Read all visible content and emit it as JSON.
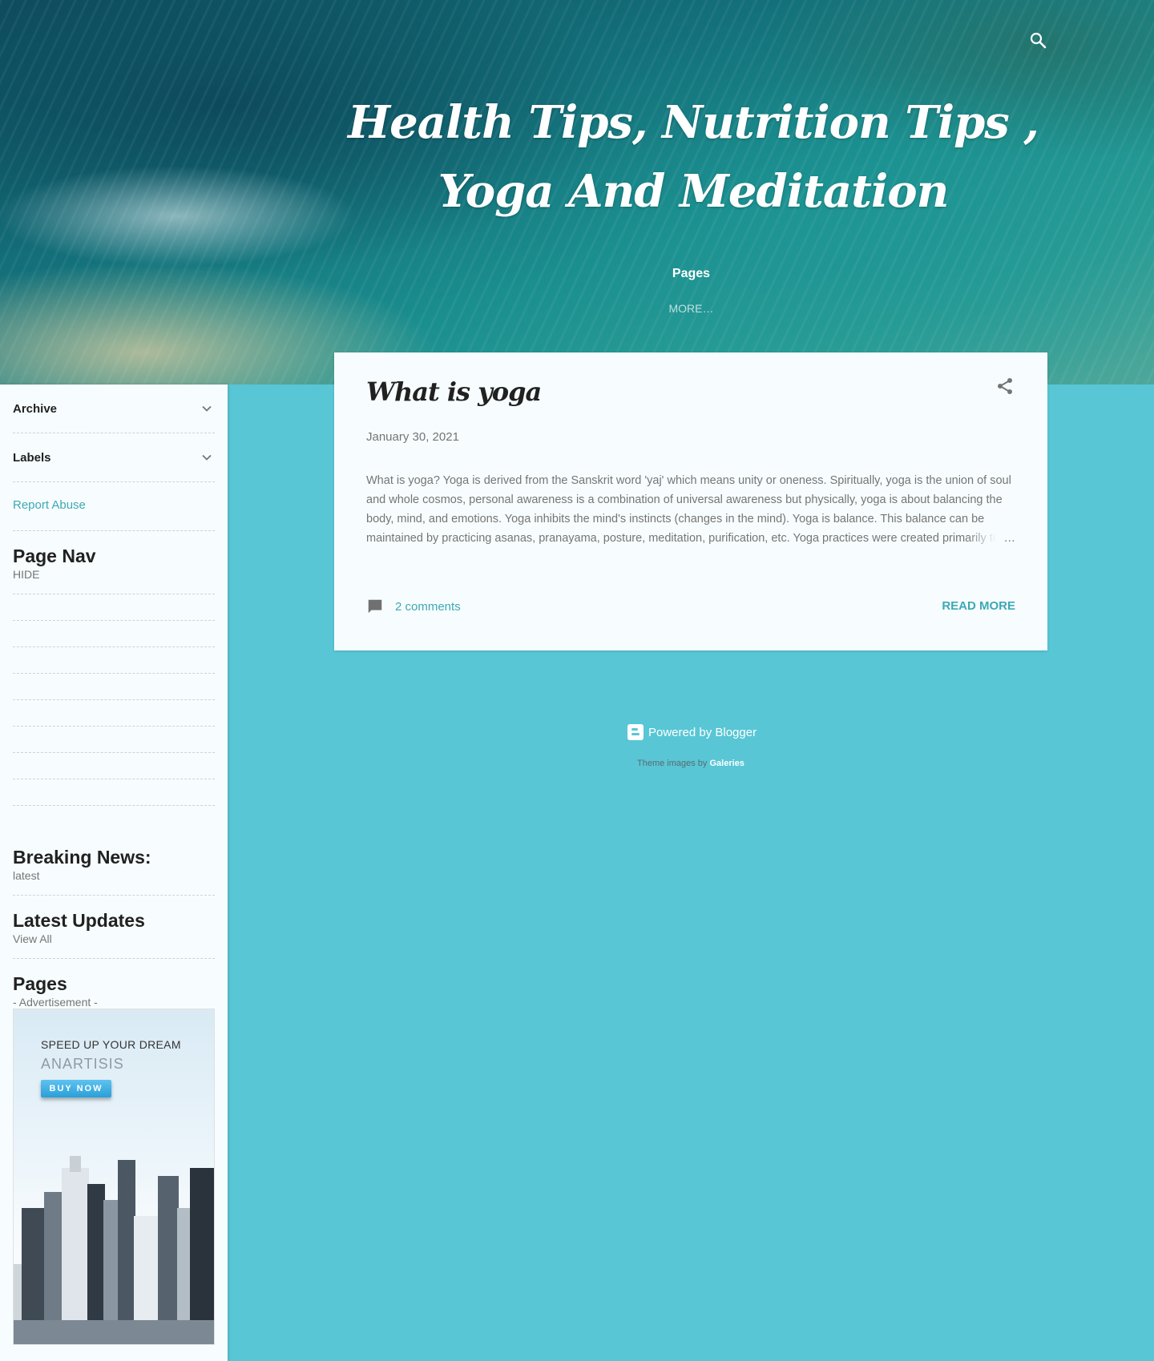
{
  "header": {
    "blog_title": "Health Tips, Nutrition Tips , Yoga And Meditation",
    "nav_pages": "Pages",
    "nav_more": "More…"
  },
  "sidebar": {
    "archive_label": "Archive",
    "labels_label": "Labels",
    "report_abuse": "Report Abuse",
    "page_nav": {
      "title": "Page Nav",
      "sub": "HIDE"
    },
    "breaking_news": {
      "title": "Breaking News:",
      "sub": "latest"
    },
    "latest_updates": {
      "title": "Latest Updates",
      "sub": "View All"
    },
    "pages": {
      "title": "Pages",
      "sub": "- Advertisement -"
    },
    "ad": {
      "line1": "SPEED UP YOUR DREAM",
      "line2": "ANARTISIS",
      "button": "BUY NOW"
    }
  },
  "post": {
    "title": "What is yoga",
    "date": "January 30, 2021",
    "snippet": "What is yoga?  Yoga is derived from the Sanskrit word 'yaj' which means unity or oneness. Spiritually, yoga is the union of soul and whole cosmos, personal awareness is a combination of universal  awareness but physically, yoga is about balancing the body, mind, and emotions. Yoga inhibits the mind's instincts (changes in the mind). Yoga is balance. This balance can be maintained by practicing asanas, pranayama, posture, meditation, purification, etc. Yoga practices were created primarily to purify the body and gain spiritual benefits. But now it is being used to cure diseases and prevent",
    "ellipsis": "…",
    "comments": "2 comments",
    "read_more": "Read more"
  },
  "footer": {
    "powered_by": "Powered by Blogger",
    "theme_credit_prefix": "Theme images by",
    "theme_credit_link": "Galeries"
  },
  "colors": {
    "accent": "#3da8b5",
    "background": "#58c6d5",
    "card": "#f7fdfe"
  }
}
